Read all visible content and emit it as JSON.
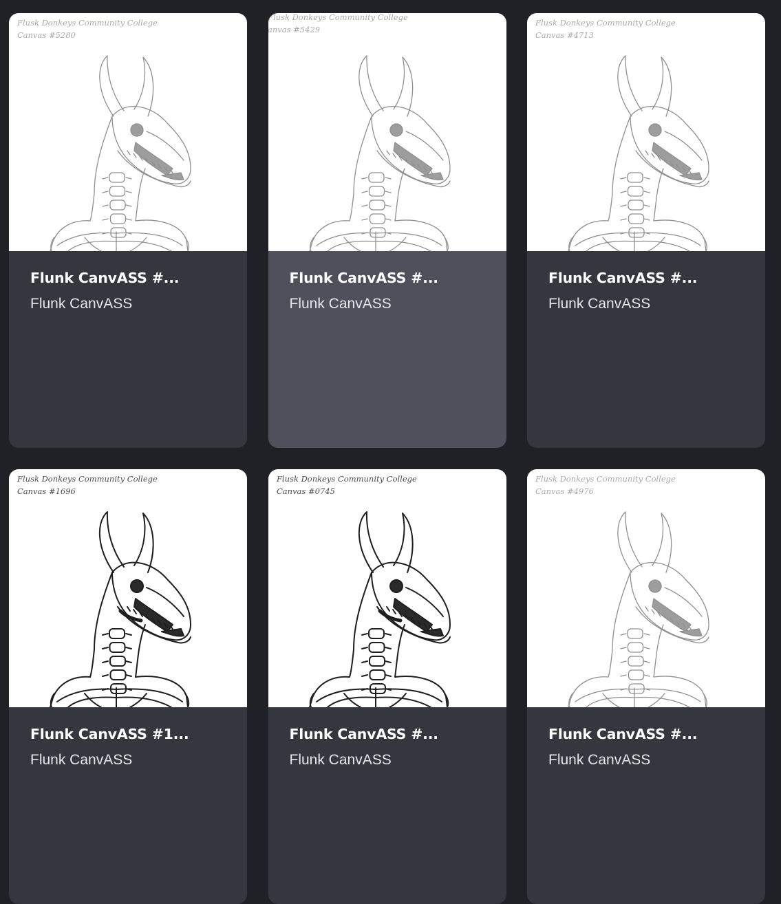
{
  "cards": [
    {
      "caption_line1": "Flusk Donkeys Community College",
      "caption_line2": "Canvas #5280",
      "title": "Flunk CanvASS #...",
      "collection": "Flunk CanvASS",
      "shade": "light",
      "hovered": false
    },
    {
      "caption_line1": "Flusk Donkeys Community College",
      "caption_line2": "anvas #5429",
      "title": "Flunk CanvASS #...",
      "collection": "Flunk CanvASS",
      "shade": "light",
      "hovered": true
    },
    {
      "caption_line1": "Flusk Donkeys Community College",
      "caption_line2": "Canvas #4713",
      "title": "Flunk CanvASS #...",
      "collection": "Flunk CanvASS",
      "shade": "light",
      "hovered": false
    },
    {
      "caption_line1": "Flusk Donkeys Community College",
      "caption_line2": "Canvas #1696",
      "title": "Flunk CanvASS #1...",
      "collection": "Flunk CanvASS",
      "shade": "dark",
      "hovered": false
    },
    {
      "caption_line1": "Flusk Donkeys Community College",
      "caption_line2": "Canvas #0745",
      "title": "Flunk CanvASS #...",
      "collection": "Flunk CanvASS",
      "shade": "dark",
      "hovered": false
    },
    {
      "caption_line1": "Flusk Donkeys Community College",
      "caption_line2": "Canvas #4976",
      "title": "Flunk CanvASS #...",
      "collection": "Flunk CanvASS",
      "shade": "light",
      "hovered": false
    }
  ],
  "colors": {
    "page_background": "#202126",
    "card_background": "#35373e",
    "card_hover_background": "#4e505b",
    "title_text": "#ffffff",
    "collection_text": "#e6e6ea"
  }
}
